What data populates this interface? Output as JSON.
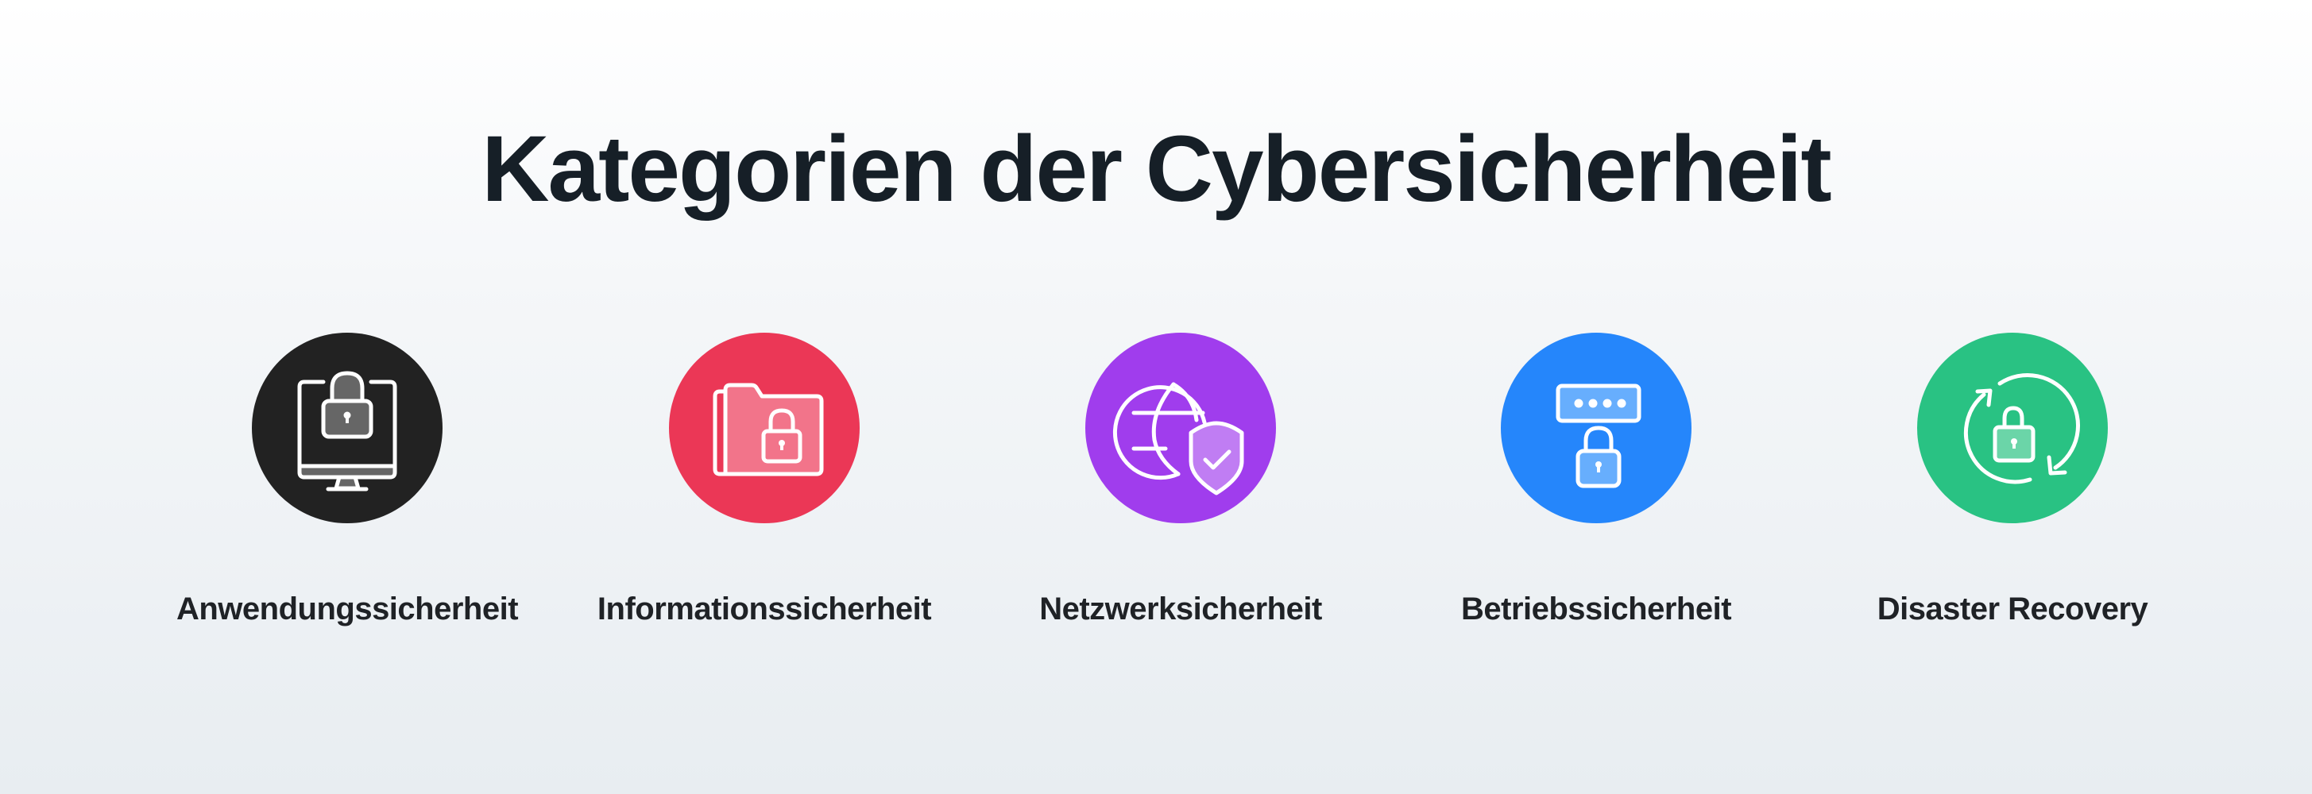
{
  "title": "Kategorien der Cybersicherheit",
  "categories": [
    {
      "label": "Anwendungssicherheit",
      "icon": "monitor-lock-icon",
      "color": "#222222",
      "tint": "#666666"
    },
    {
      "label": "Informationssicherheit",
      "icon": "folder-lock-icon",
      "color": "#eb3756",
      "tint": "#f2748a"
    },
    {
      "label": "Netzwerksicherheit",
      "icon": "globe-shield-icon",
      "color": "#a03ded",
      "tint": "#c07df3"
    },
    {
      "label": "Betriebssicherheit",
      "icon": "password-lock-icon",
      "color": "#2586fb",
      "tint": "#67aefd"
    },
    {
      "label": "Disaster Recovery",
      "icon": "recovery-lock-icon",
      "color": "#29c283",
      "tint": "#6bd5a8"
    }
  ]
}
